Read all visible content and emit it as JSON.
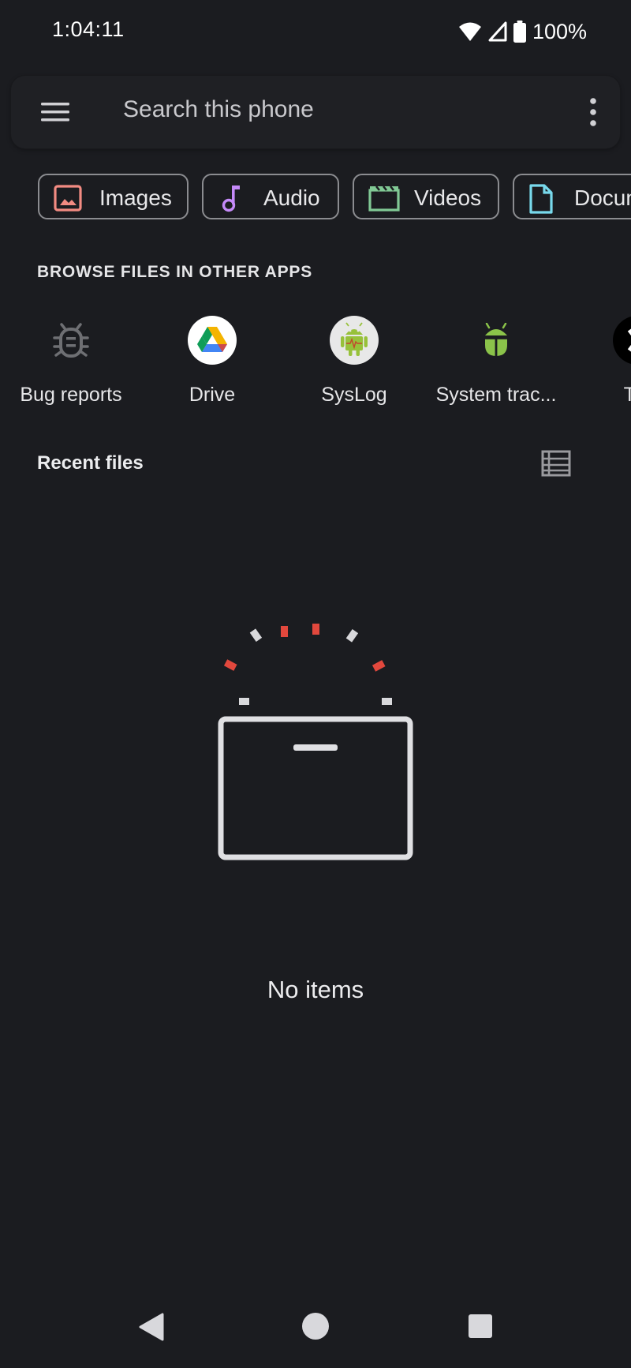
{
  "status": {
    "time": "1:04:11",
    "battery": "100%"
  },
  "search": {
    "placeholder": "Search this phone"
  },
  "categories": [
    {
      "label": "Images",
      "icon": "image-icon",
      "color": "#f28b82"
    },
    {
      "label": "Audio",
      "icon": "music-note-icon",
      "color": "#c58af9"
    },
    {
      "label": "Videos",
      "icon": "clapperboard-icon",
      "color": "#81c995"
    },
    {
      "label": "Docum",
      "icon": "document-icon",
      "color": "#78d9ec"
    }
  ],
  "browse": {
    "heading": "BROWSE FILES IN OTHER APPS",
    "apps": [
      {
        "label": "Bug reports",
        "icon": "bug-icon"
      },
      {
        "label": "Drive",
        "icon": "google-drive-icon"
      },
      {
        "label": "SysLog",
        "icon": "android-icon"
      },
      {
        "label": "System trac...",
        "icon": "system-trace-icon"
      },
      {
        "label": "Ter",
        "icon": "terminal-x-icon"
      }
    ]
  },
  "recent": {
    "heading": "Recent files"
  },
  "empty_state": {
    "message": "No items"
  },
  "colors": {
    "background": "#1b1c20",
    "accent_red": "#e2483d",
    "outline": "#8b8c90"
  }
}
